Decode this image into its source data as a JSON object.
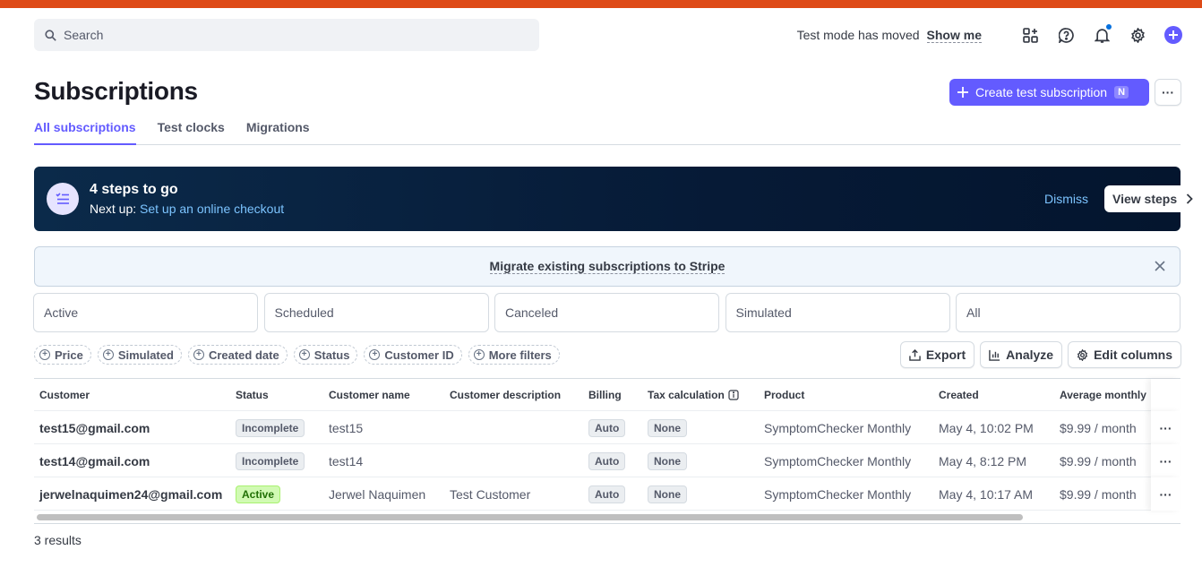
{
  "colors": {
    "accent": "#635bff",
    "topbar": "#de4a17",
    "banner": "#061a36",
    "active_badge": "#d1fab3"
  },
  "search": {
    "placeholder": "Search"
  },
  "header": {
    "test_mode_text": "Test mode has moved",
    "show_me": "Show me",
    "icons": [
      "apps-icon",
      "help-icon",
      "bell-icon",
      "gear-icon",
      "plus-icon"
    ]
  },
  "page": {
    "title": "Subscriptions",
    "create_button": "Create test subscription",
    "create_shortcut": "N",
    "more": "···"
  },
  "tabs": [
    {
      "label": "All subscriptions",
      "active": true
    },
    {
      "label": "Test clocks",
      "active": false
    },
    {
      "label": "Migrations",
      "active": false
    }
  ],
  "banner": {
    "title": "4 steps to go",
    "next_prefix": "Next up:",
    "next_link": "Set up an online checkout",
    "dismiss": "Dismiss",
    "view_steps": "View steps"
  },
  "migrate": {
    "text": "Migrate existing subscriptions to Stripe"
  },
  "status_cards": [
    "Active",
    "Scheduled",
    "Canceled",
    "Simulated",
    "All"
  ],
  "filters": [
    "Price",
    "Simulated",
    "Created date",
    "Status",
    "Customer ID",
    "More filters"
  ],
  "actions": {
    "export": "Export",
    "analyze": "Analyze",
    "edit_columns": "Edit columns"
  },
  "table": {
    "columns": [
      "Customer",
      "Status",
      "Customer name",
      "Customer description",
      "Billing",
      "Tax calculation",
      "Product",
      "Created",
      "Average monthly"
    ],
    "rows": [
      {
        "customer": "test15@gmail.com",
        "status": "Incomplete",
        "status_type": "incomplete",
        "name": "test15",
        "description": "",
        "billing": "Auto",
        "tax": "None",
        "product": "SymptomChecker Monthly",
        "created": "May 4, 10:02 PM",
        "avg": "$9.99 / month"
      },
      {
        "customer": "test14@gmail.com",
        "status": "Incomplete",
        "status_type": "incomplete",
        "name": "test14",
        "description": "",
        "billing": "Auto",
        "tax": "None",
        "product": "SymptomChecker Monthly",
        "created": "May 4, 8:12 PM",
        "avg": "$9.99 / month"
      },
      {
        "customer": "jerwelnaquimen24@gmail.com",
        "status": "Active",
        "status_type": "active",
        "name": "Jerwel Naquimen",
        "description": "Test Customer",
        "billing": "Auto",
        "tax": "None",
        "product": "SymptomChecker Monthly",
        "created": "May 4, 10:17 AM",
        "avg": "$9.99 / month"
      }
    ],
    "row_more": "···"
  },
  "footer": {
    "results": "3 results"
  }
}
